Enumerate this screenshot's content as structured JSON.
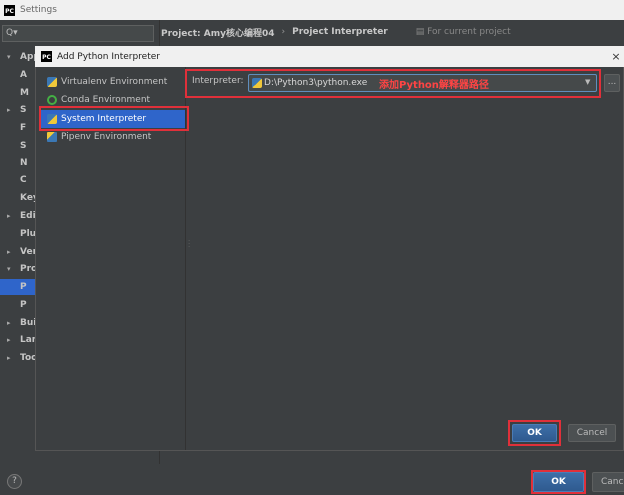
{
  "settings": {
    "window_title": "Settings",
    "search_placeholder": "Q▾",
    "header": {
      "project_crumb": "Project: Amy核心编程04",
      "separator": "›",
      "page": "Project Interpreter",
      "for_current_project": "For current project"
    },
    "tree": [
      {
        "label": "App",
        "arrow": "▾"
      },
      {
        "label": "A",
        "arrow": ""
      },
      {
        "label": "M",
        "arrow": ""
      },
      {
        "label": "S",
        "arrow": "▸"
      },
      {
        "label": "F",
        "arrow": ""
      },
      {
        "label": "S",
        "arrow": ""
      },
      {
        "label": "N",
        "arrow": ""
      },
      {
        "label": "C",
        "arrow": ""
      },
      {
        "label": "Key",
        "arrow": ""
      },
      {
        "label": "Edit",
        "arrow": "▸"
      },
      {
        "label": "Plu",
        "arrow": ""
      },
      {
        "label": "Ver",
        "arrow": "▸"
      },
      {
        "label": "Pro",
        "arrow": "▾"
      },
      {
        "label": "P",
        "arrow": ""
      },
      {
        "label": "P",
        "arrow": ""
      },
      {
        "label": "Bui",
        "arrow": "▸"
      },
      {
        "label": "Lan",
        "arrow": "▸"
      },
      {
        "label": "Too",
        "arrow": "▸"
      }
    ],
    "help_label": "?",
    "ok_label": "OK",
    "cancel_label": "Canc"
  },
  "dialog": {
    "title": "Add Python Interpreter",
    "close_label": "×",
    "environments": [
      {
        "label": "Virtualenv Environment",
        "icon": "python-icon"
      },
      {
        "label": "Conda Environment",
        "icon": "conda-icon"
      },
      {
        "label": "System Interpreter",
        "icon": "python-icon"
      },
      {
        "label": "Pipenv Environment",
        "icon": "pipenv-icon"
      }
    ],
    "interpreter_label": "Interpreter:",
    "interpreter_value": "D:\\Python3\\python.exe",
    "annotation": "添加Python解释器路径",
    "browse_label": "...",
    "ok_label": "OK",
    "cancel_label": "Cancel"
  },
  "colors": {
    "highlight_red": "#e0303a",
    "selection_blue": "#2f65ca",
    "background": "#3c3f41"
  }
}
